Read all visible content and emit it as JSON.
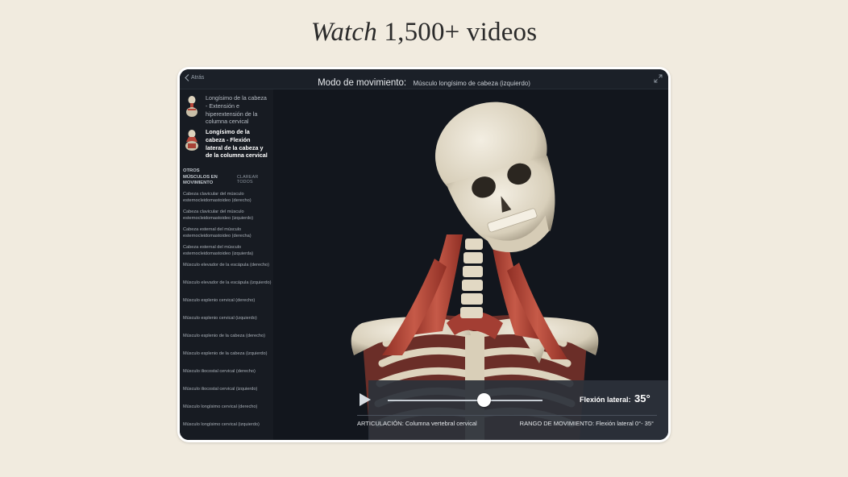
{
  "headline": {
    "italic": "Watch",
    "rest": " 1,500+ videos"
  },
  "topbar": {
    "back_label": "Atrás",
    "title_main": "Modo de movimiento:",
    "title_sub": "Músculo longísimo de cabeza (izquierdo)"
  },
  "sidebar": {
    "animations": [
      {
        "label": "Longísimo de la cabeza - Extensión e hiperextensión de la columna cervical",
        "active": false
      },
      {
        "label": "Longísimo de la cabeza - Flexión lateral de la cabeza y de la columna cervical",
        "active": true
      }
    ],
    "section_title": "OTROS MÚSCULOS EN MOVIMIENTO",
    "clear_all": "CLAREAR TODOS",
    "muscles": [
      "Cabeza clavicular del músculo esternocleidomastoideo (derecho)",
      "Cabeza clavicular del músculo esternocleidomastoideo (izquierdo)",
      "Cabeza esternal del músculo esternocleidomastoideo (derecha)",
      "Cabeza esternal del músculo esternocleidomastoideo (izquierda)",
      "Músculo elevador de la escápula (derecho)",
      "Músculo elevador de la escápula (izquierdo)",
      "Músculo esplenio cervical (derecho)",
      "Músculo esplenio cervical (izquierdo)",
      "Músculo esplenio de la cabeza (derecho)",
      "Músculo esplenio de la cabeza (izquierdo)",
      "Músculo iliocostal cervical (derecho)",
      "Músculo iliocostal cervical (izquierdo)",
      "Músculo longísimo cervical (derecho)",
      "Músculo longísimo cervical (izquierdo)"
    ]
  },
  "controls": {
    "slider_fraction": 0.62,
    "flexion_label": "Flexión lateral:",
    "flexion_value": "35°",
    "articulacion": "ARTICULACIÓN: Columna vertebral cervical",
    "rango": "RANGO DE MOVIMIENTO: Flexión lateral 0°- 35°"
  },
  "colors": {
    "background": "#f1ebdf",
    "screen": "#12161d",
    "muscle": "#b8473a",
    "bone": "#e8e1cf"
  },
  "icons": [
    "back-chevron-icon",
    "expand-icon",
    "play-icon"
  ]
}
